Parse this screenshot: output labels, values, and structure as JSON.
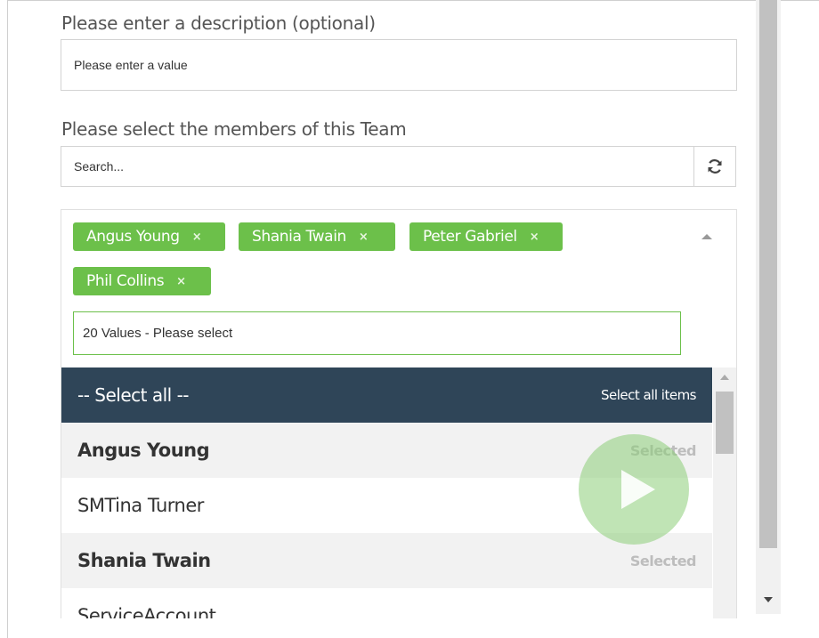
{
  "description": {
    "label": "Please enter a description (optional)",
    "placeholder": "Please enter a value"
  },
  "members": {
    "label": "Please select the members of this Team",
    "search_placeholder": "Search...",
    "refresh_icon": "refresh-icon",
    "tags": [
      {
        "name": "Angus Young",
        "remove": "×"
      },
      {
        "name": "Shania Twain",
        "remove": "×"
      },
      {
        "name": "Peter Gabriel",
        "remove": "×"
      },
      {
        "name": "Phil Collins",
        "remove": "×"
      }
    ],
    "combo_text": "20 Values - Please select",
    "list": {
      "select_all": "-- Select all --",
      "select_all_hint": "Select all items",
      "items": [
        {
          "name": "Angus Young",
          "status": "Selected"
        },
        {
          "name": "SMTina Turner",
          "status": ""
        },
        {
          "name": "Shania Twain",
          "status": "Selected"
        },
        {
          "name": "ServiceAccount",
          "status": ""
        }
      ]
    }
  },
  "colors": {
    "tag": "#6cc04a",
    "header": "#2f4558"
  }
}
